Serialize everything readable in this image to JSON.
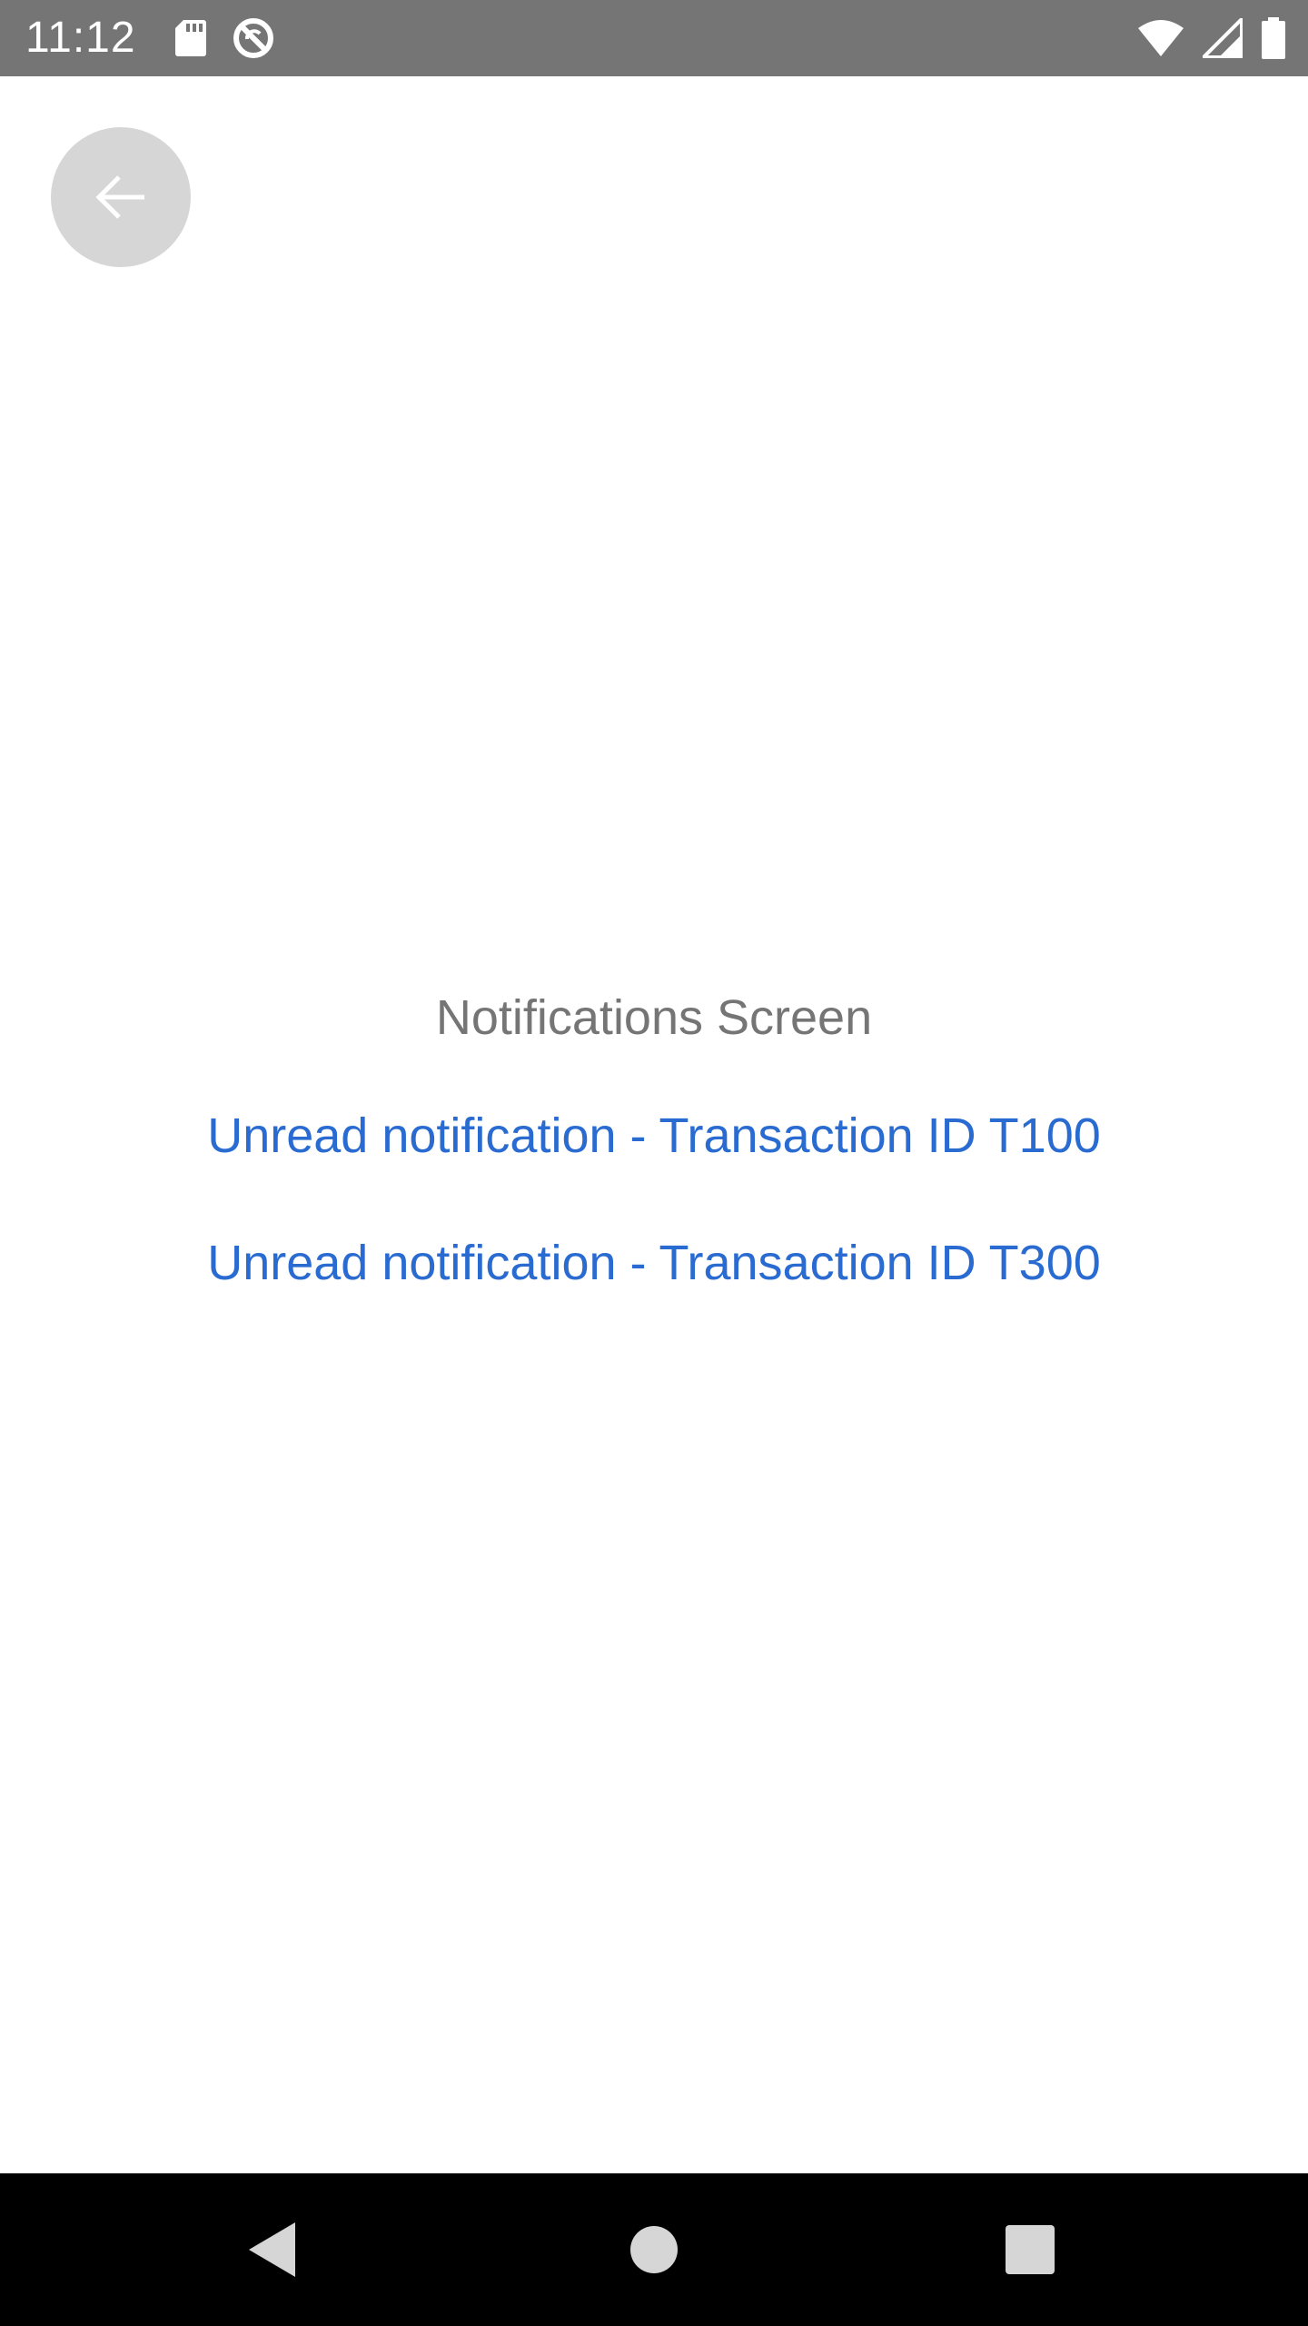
{
  "status_bar": {
    "time": "11:12",
    "icons_left": [
      "sd-card-icon",
      "no-sync-icon"
    ],
    "icons_right": [
      "wifi-icon",
      "signal-icon",
      "battery-icon"
    ]
  },
  "header": {
    "back_icon": "arrow-left-icon"
  },
  "main": {
    "title": "Notifications Screen",
    "notifications": [
      {
        "label": "Unread notification - Transaction ID T100"
      },
      {
        "label": "Unread notification - Transaction ID T300"
      }
    ]
  },
  "nav_bar": {
    "buttons": [
      "back-triangle-icon",
      "home-circle-icon",
      "recents-square-icon"
    ]
  },
  "colors": {
    "status_bar": "#757575",
    "link": "#2a6bd1",
    "title": "#757575",
    "back_button_bg": "#d6d6d6",
    "nav_bar": "#000000"
  }
}
